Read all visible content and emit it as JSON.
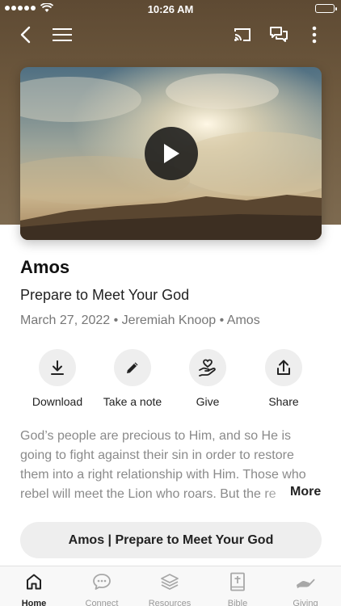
{
  "status_bar": {
    "time": "10:26 AM"
  },
  "sermon": {
    "title": "Amos",
    "subtitle": "Prepare to Meet Your God",
    "meta": "March 27, 2022 • Jeremiah Knoop • Amos",
    "description_lines": [
      "God’s people are precious to Him, and so He is",
      "going to fight against their sin in order to restore",
      "them into a right relationship with Him. Those who",
      "rebel will meet the Lion who roars. But the re"
    ],
    "more_label": "More",
    "series_button": "Amos | Prepare to Meet Your God"
  },
  "actions": [
    {
      "label": "Download",
      "icon": "download-icon"
    },
    {
      "label": "Take a note",
      "icon": "pencil-icon"
    },
    {
      "label": "Give",
      "icon": "give-hand-heart-icon"
    },
    {
      "label": "Share",
      "icon": "share-icon"
    }
  ],
  "tabs": [
    {
      "label": "Home",
      "icon": "home-icon",
      "active": true
    },
    {
      "label": "Connect",
      "icon": "chat-bubble-icon",
      "active": false
    },
    {
      "label": "Resources",
      "icon": "layers-icon",
      "active": false
    },
    {
      "label": "Bible",
      "icon": "bible-icon",
      "active": false
    },
    {
      "label": "Giving",
      "icon": "giving-hand-icon",
      "active": false
    }
  ]
}
